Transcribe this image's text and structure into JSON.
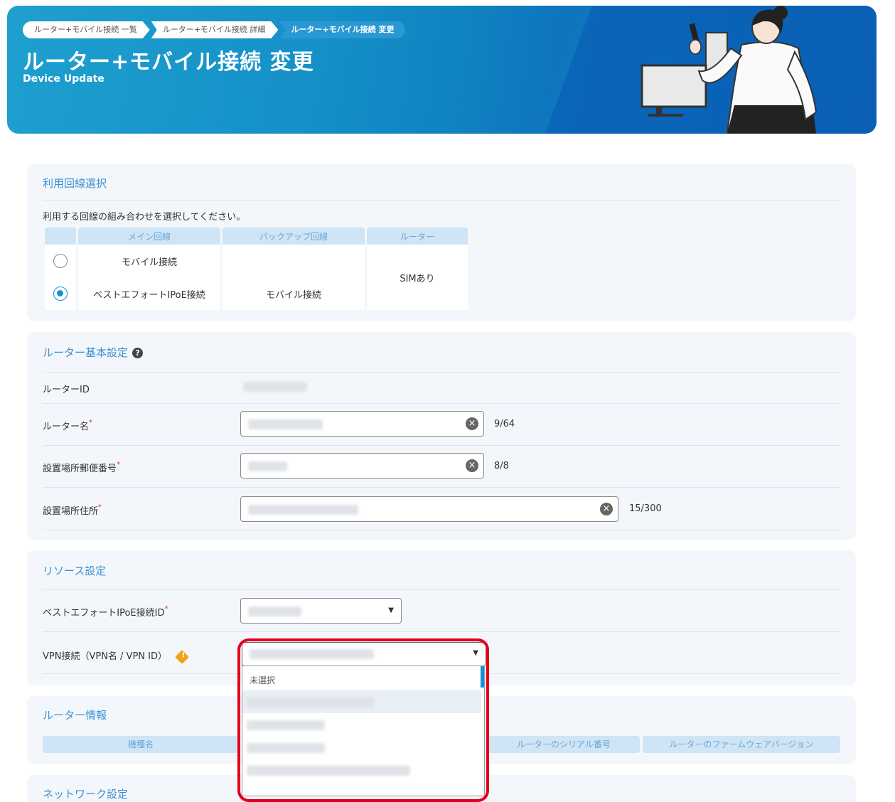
{
  "breadcrumb": [
    "ルーター+モバイル接続 一覧",
    "ルーター+モバイル接続 詳細",
    "ルーター+モバイル接続 変更"
  ],
  "header": {
    "title": "ルーター+モバイル接続 変更",
    "subtitle": "Device Update"
  },
  "line_selection": {
    "title": "利用回線選択",
    "description": "利用する回線の組み合わせを選択してください。",
    "columns": [
      "メイン回線",
      "バックアップ回線",
      "ルーター"
    ],
    "options": [
      {
        "selected": false,
        "main": "モバイル接続",
        "backup": ""
      },
      {
        "selected": true,
        "main": "ベストエフォートIPoE接続",
        "backup": "モバイル接続"
      }
    ],
    "router": "SIMあり"
  },
  "router_basic": {
    "title": "ルーター基本設定",
    "help_icon": "?",
    "router_id_label": "ルーターID",
    "router_name_label": "ルーター名",
    "router_name_count": "9/64",
    "zip_label": "設置場所郵便番号",
    "zip_count": "8/8",
    "address_label": "設置場所住所",
    "address_count": "15/300",
    "required_mark": "*"
  },
  "resource": {
    "title": "リソース設定",
    "ipoe_label": "ベストエフォートIPoE接続ID",
    "vpn_label": "VPN接続（VPN名 / VPN ID）",
    "warn_icon": "!",
    "dropdown_first_option": "未選択"
  },
  "router_info": {
    "title": "ルーター情報",
    "columns": [
      "機種名",
      "ルーターのシリアル番号",
      "ルーターのファームウェアバージョン"
    ]
  },
  "network": {
    "title": "ネットワーク設定"
  },
  "colors": {
    "accent": "#3a8fd1",
    "banner": "#0f7cc0",
    "highlight": "#e4001c"
  }
}
